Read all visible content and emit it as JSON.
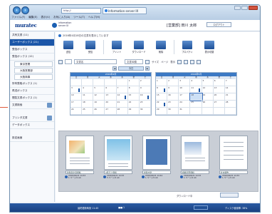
{
  "browser": {
    "address": "http://",
    "tab_title": "Information server IX",
    "menu": [
      "ファイル(F)",
      "編集(E)",
      "表示(V)",
      "お気に入り(A)",
      "ツール(T)",
      "ヘルプ(H)"
    ]
  },
  "app": {
    "logo": "muratec",
    "subtitle_line1": "information",
    "subtitle_line2": "server IX",
    "user": "[営業部] 田川 太郎",
    "logout": "ログアウト"
  },
  "sidebar": {
    "items": [
      {
        "label": "共有文書 (11)"
      },
      {
        "label": "ユーザーボックス (21)"
      },
      {
        "label": "受信ボックス"
      },
      {
        "label": "受信ボックス (12)"
      },
      {
        "label": "東京営業"
      },
      {
        "label": "大阪営業部"
      },
      {
        "label": "大阪商事"
      },
      {
        "label": "所有受取ボックス (1)"
      },
      {
        "label": "再送ボックス"
      },
      {
        "label": "閲覧文書ボックス (1)"
      },
      {
        "label": "文書検索"
      },
      {
        "label": "プリンタ文書"
      },
      {
        "label": "データボックス"
      },
      {
        "label": "設定画面"
      }
    ]
  },
  "notice": "2016年4月18日の文書を表示しています",
  "toolbar": {
    "buttons": [
      "送信",
      "受信",
      "プリント",
      "ダウンロード",
      "削除",
      "プロパティ",
      "表示切替"
    ]
  },
  "filter": {
    "field": "文書名",
    "sort": "文書ID順",
    "size_label": "サイズ",
    "page_label": "ページ",
    "display_label": "表示"
  },
  "calendar": {
    "today_label": "今日",
    "months": [
      "2016年3月",
      "2016年4月",
      "2016年5月"
    ],
    "weekdays": [
      "日",
      "月",
      "火",
      "水",
      "木",
      "金",
      "土"
    ]
  },
  "documents": [
    {
      "caption": "新製品企画資料",
      "date": "2016/04/21 14:33",
      "pages": "1 ページ/1 A4"
    },
    {
      "caption": "3月売上資料",
      "date": "2016/04/21 14:33",
      "pages": "3 ページ/1 A4"
    },
    {
      "caption": "営業方針",
      "date": "2016/04/21 14:44",
      "pages": "1 ページ/1 A4"
    },
    {
      "caption": "組織変更資料",
      "date": "2016/04/21 14:33",
      "pages": "1 ページ/1 A4"
    },
    {
      "caption": "社内報告",
      "date": "2016/04/21 14:33",
      "pages": "1 ページ/1 A4"
    }
  ],
  "legend": "ダウンロード中",
  "status": {
    "left": "最終更新時刻 11:45",
    "mid": "■■ 1",
    "right": "ディスク使用率: 38%"
  },
  "colors": {
    "brand": "#1b56a8",
    "accent": "#e05a3a"
  }
}
